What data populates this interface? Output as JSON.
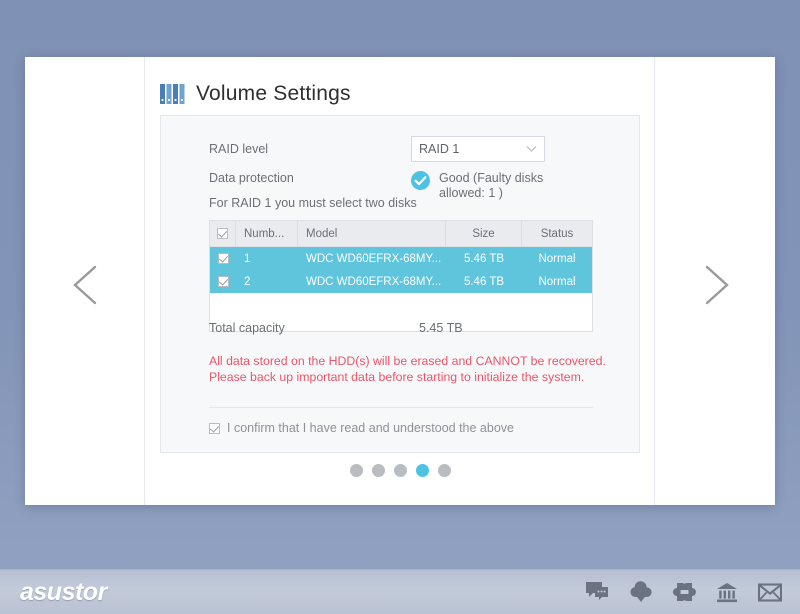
{
  "header": {
    "title": "Volume Settings",
    "icon": "disk-bars-icon"
  },
  "form": {
    "raid_level_label": "RAID level",
    "raid_level_value": "RAID 1",
    "raid_level_options": [
      "RAID 1"
    ],
    "data_protection_label": "Data protection",
    "data_protection_status": "Good (Faulty disks allowed: 1 )",
    "data_protection_icon": "check-circle-icon",
    "hint": "For RAID 1 you must select two disks"
  },
  "disk_table": {
    "columns": [
      "Numb...",
      "Model",
      "Size",
      "Status"
    ],
    "header_checkbox_checked": true,
    "rows": [
      {
        "checked": true,
        "number": "1",
        "model": "WDC WD60EFRX-68MY...",
        "size": "5.46 TB",
        "status": "Normal"
      },
      {
        "checked": true,
        "number": "2",
        "model": "WDC WD60EFRX-68MY...",
        "size": "5.46 TB",
        "status": "Normal"
      }
    ]
  },
  "summary": {
    "total_capacity_label": "Total capacity",
    "total_capacity_value": "5.45 TB"
  },
  "warning": {
    "line1": "All data stored on the HDD(s) will be erased and CANNOT be recovered.",
    "line2": "Please back up important data before starting to initialize the system.",
    "color": "#e8566a"
  },
  "confirm": {
    "label": "I confirm that I have read and understood the above",
    "checked": true
  },
  "pagination": {
    "total": 5,
    "active_index": 3,
    "active_color": "#4cc3e3",
    "inactive_color": "#b9bdc2"
  },
  "navigation": {
    "prev_icon": "chevron-left-icon",
    "next_icon": "chevron-right-icon"
  },
  "footer": {
    "brand": "asustor",
    "icons": [
      "chat-bubble-icon",
      "cloud-download-icon",
      "puzzle-apps-icon",
      "bank-college-icon",
      "envelope-mail-icon"
    ]
  },
  "theme": {
    "accent": "#4cc3e3",
    "row_selected": "#5ec5dd",
    "desktop_background": "#8294b7"
  }
}
